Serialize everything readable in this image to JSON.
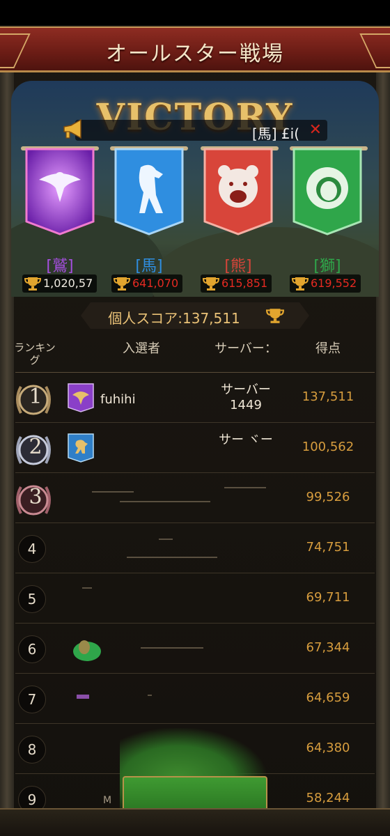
{
  "header": {
    "title": "オールスター戦場"
  },
  "result": {
    "text": "VICTORY"
  },
  "chat": {
    "text": "[馬] £i(",
    "close_icon": "close-x-icon"
  },
  "teams": [
    {
      "name": "[鷲]",
      "score": "1,020,57",
      "color": "#a64fe0",
      "score_color": "#f0ece2",
      "animal": "eagle"
    },
    {
      "name": "[馬]",
      "score": "641,070",
      "color": "#2f8ee0",
      "score_color": "#e52a22",
      "animal": "horse"
    },
    {
      "name": "[熊]",
      "score": "615,851",
      "color": "#d8453a",
      "score_color": "#e52a22",
      "animal": "bear"
    },
    {
      "name": "[獅]",
      "score": "619,552",
      "color": "#2fa64a",
      "score_color": "#e52a22",
      "animal": "lion"
    }
  ],
  "personal": {
    "label": "個人スコア:137,511"
  },
  "columns": {
    "rank": "ランキング",
    "candidate": "入選者",
    "server": "サーバー：",
    "score": "得点"
  },
  "rankings": [
    {
      "rank": "1",
      "name": "fuhihi",
      "server_line1": "サーバー",
      "server_line2": "1449",
      "score": "137,511",
      "emblem": "eagle-banner"
    },
    {
      "rank": "2",
      "name": "",
      "server_line1": "サー ヾー",
      "server_line2": "",
      "score": "100,562",
      "emblem": "horse-banner"
    },
    {
      "rank": "3",
      "name": "",
      "server_line1": "",
      "server_line2": "",
      "score": "99,526",
      "emblem": ""
    },
    {
      "rank": "4",
      "name": "",
      "server_line1": "",
      "server_line2": "",
      "score": "74,751",
      "emblem": ""
    },
    {
      "rank": "5",
      "name": "",
      "server_line1": "",
      "server_line2": "",
      "score": "69,711",
      "emblem": ""
    },
    {
      "rank": "6",
      "name": "",
      "server_line1": "",
      "server_line2": "",
      "score": "67,344",
      "emblem": "lion-blob"
    },
    {
      "rank": "7",
      "name": "",
      "server_line1": "",
      "server_line2": "",
      "score": "64,659",
      "emblem": ""
    },
    {
      "rank": "8",
      "name": "",
      "server_line1": "",
      "server_line2": "",
      "score": "64,380",
      "emblem": ""
    },
    {
      "rank": "9",
      "name": "M",
      "server_line1": "",
      "server_line2": "",
      "score": "58,244",
      "emblem": ""
    }
  ]
}
